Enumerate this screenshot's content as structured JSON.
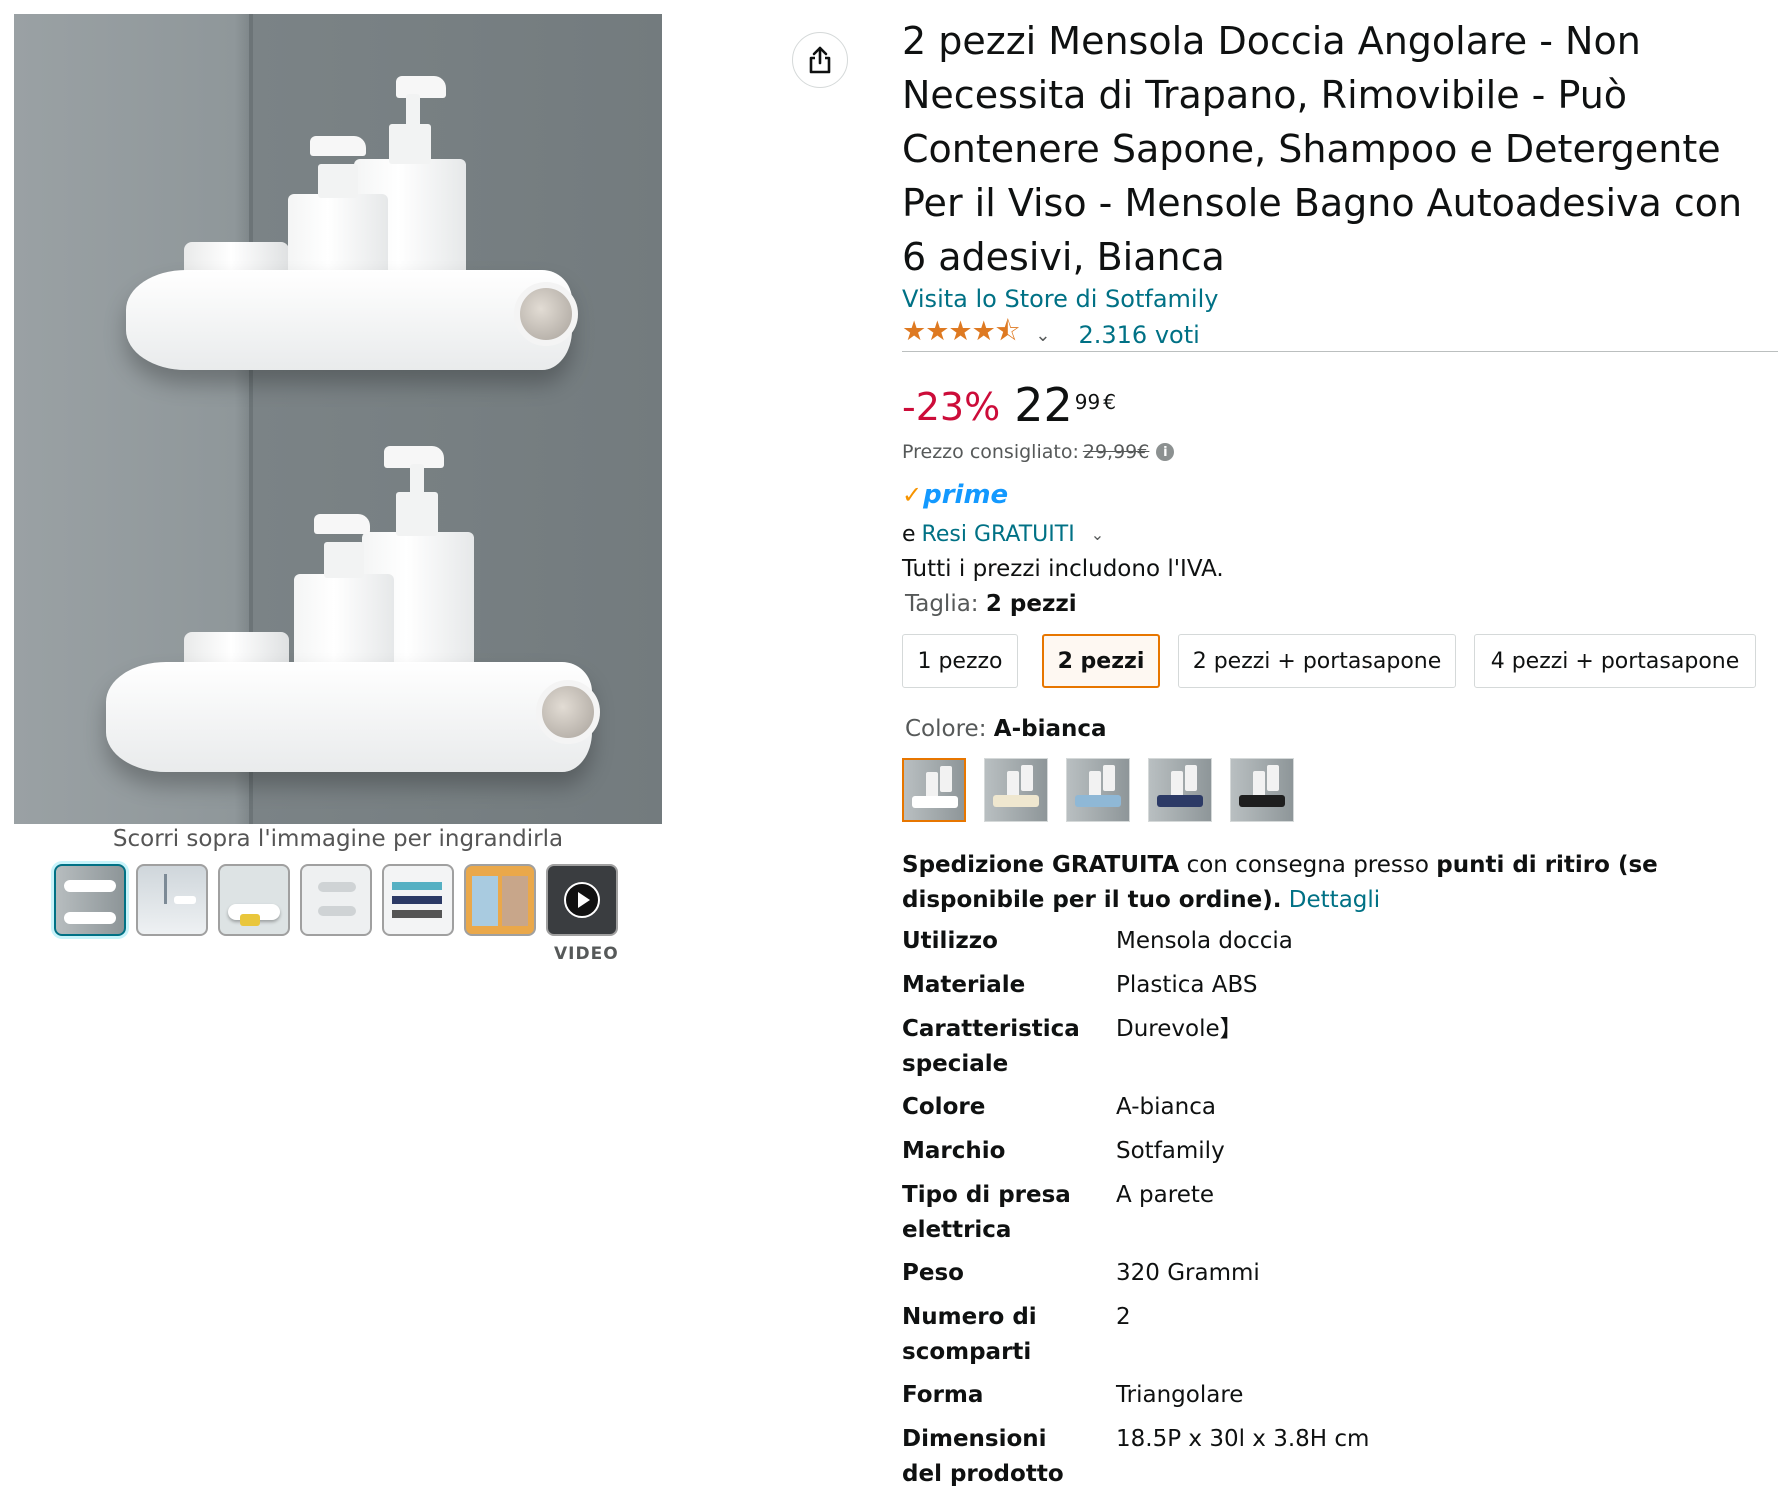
{
  "gallery": {
    "zoom_hint": "Scorri sopra l'immagine per ingrandirla",
    "video_label": "VIDEO",
    "thumbnail_count": 7,
    "selected_thumbnail": 1
  },
  "product": {
    "title": "2 pezzi Mensola Doccia Angolare - Non Necessita di Trapano, Rimovibile - Può Contenere Sapone, Shampoo e Detergente Per il Viso - Mensole Bagno Autoadesiva con 6 adesivi, Bianca",
    "store_link": "Visita lo Store di Sotfamily",
    "rating_stars": 4.5,
    "rating_count": "2.316 voti"
  },
  "price": {
    "discount": "-23%",
    "whole": "22",
    "fraction": "99",
    "currency": "€",
    "list_price_label": "Prezzo consigliato:",
    "list_price_value": "29,99€"
  },
  "prime": {
    "word": "prime"
  },
  "returns": {
    "prefix": "e",
    "link": "Resi GRATUITI"
  },
  "vat_note": "Tutti i prezzi includono l'IVA.",
  "size": {
    "label": "Taglia:",
    "selected": "2 pezzi",
    "options": [
      "1 pezzo",
      "2 pezzi",
      "2 pezzi + portasapone",
      "4 pezzi + portasapone"
    ]
  },
  "color": {
    "label": "Colore:",
    "selected": "A-bianca",
    "swatch_colors": [
      "#ffffff",
      "#efe7cf",
      "#8fb8d6",
      "#2c3a66",
      "#1e1e1e"
    ]
  },
  "shipping": {
    "bold1": "Spedizione GRATUITA",
    "text1": " con consegna presso ",
    "bold2": "punti di ritiro (se disponibile per il tuo ordine).",
    "link": "Dettagli"
  },
  "specs": [
    {
      "key": "Utilizzo",
      "value": "Mensola doccia"
    },
    {
      "key": "Materiale",
      "value": "Plastica ABS"
    },
    {
      "key": "Caratteristica speciale",
      "value": "Durevole】"
    },
    {
      "key": "Colore",
      "value": "A-bianca"
    },
    {
      "key": "Marchio",
      "value": "Sotfamily"
    },
    {
      "key": "Tipo di presa elettrica",
      "value": "A parete"
    },
    {
      "key": "Peso",
      "value": "320 Grammi"
    },
    {
      "key": "Numero di scomparti",
      "value": "2"
    },
    {
      "key": "Forma",
      "value": "Triangolare"
    },
    {
      "key": "Dimensioni del prodotto",
      "value": "18.5P x 30l x 3.8H cm"
    }
  ]
}
